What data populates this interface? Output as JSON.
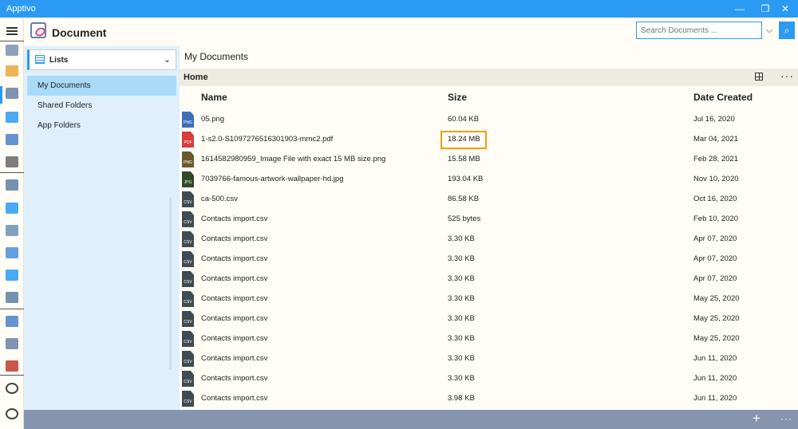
{
  "window": {
    "title": "Apptivo",
    "minimize": "—",
    "restore": "❐",
    "close": "✕"
  },
  "header": {
    "title": "Document",
    "search_placeholder": "Search Documents ...",
    "dropdown_glyph": "⌵",
    "search_glyph": "⌕"
  },
  "sidebar": {
    "select_label": "Lists",
    "select_chevron": "⌄",
    "items": [
      {
        "label": "My Documents",
        "active": true
      },
      {
        "label": "Shared Folders",
        "active": false
      },
      {
        "label": "App Folders",
        "active": false
      }
    ]
  },
  "main": {
    "breadcrumb": "My Documents",
    "folder": "Home",
    "more_glyph": "···",
    "columns": {
      "name": "Name",
      "size": "Size",
      "date": "Date Created"
    },
    "files": [
      {
        "name": "05.png",
        "size": "60.04 KB",
        "date": "Jul 16, 2020",
        "type": "PNG",
        "color": "#3d6fb6"
      },
      {
        "name": "1-s2.0-S1097276516301903-mmc2.pdf",
        "size": "18.24 MB",
        "date": "Mar 04, 2021",
        "type": "PDF",
        "color": "#d93c3c"
      },
      {
        "name": "1614582980959_Image File with exact 15 MB size.png",
        "size": "15.58 MB",
        "date": "Feb 28, 2021",
        "type": "PNG",
        "color": "#6b5a2a"
      },
      {
        "name": "7039766-famous-artwork-wallpaper-hd.jpg",
        "size": "193.04 KB",
        "date": "Nov 10, 2020",
        "type": "JPG",
        "color": "#2f4a2a"
      },
      {
        "name": "ca-500.csv",
        "size": "86.58 KB",
        "date": "Oct 16, 2020",
        "type": "CSV",
        "color": "#3e4b52"
      },
      {
        "name": "Contacts import.csv",
        "size": "525 bytes",
        "date": "Feb 10, 2020",
        "type": "CSV",
        "color": "#3e4b52"
      },
      {
        "name": "Contacts import.csv",
        "size": "3.30 KB",
        "date": "Apr 07, 2020",
        "type": "CSV",
        "color": "#3e4b52"
      },
      {
        "name": "Contacts import.csv",
        "size": "3.30 KB",
        "date": "Apr 07, 2020",
        "type": "CSV",
        "color": "#3e4b52"
      },
      {
        "name": "Contacts import.csv",
        "size": "3.30 KB",
        "date": "Apr 07, 2020",
        "type": "CSV",
        "color": "#3e4b52"
      },
      {
        "name": "Contacts import.csv",
        "size": "3.30 KB",
        "date": "May 25, 2020",
        "type": "CSV",
        "color": "#3e4b52"
      },
      {
        "name": "Contacts import.csv",
        "size": "3.30 KB",
        "date": "May 25, 2020",
        "type": "CSV",
        "color": "#3e4b52"
      },
      {
        "name": "Contacts import.csv",
        "size": "3.30 KB",
        "date": "May 25, 2020",
        "type": "CSV",
        "color": "#3e4b52"
      },
      {
        "name": "Contacts import.csv",
        "size": "3.30 KB",
        "date": "Jun 11, 2020",
        "type": "CSV",
        "color": "#3e4b52"
      },
      {
        "name": "Contacts import.csv",
        "size": "3.30 KB",
        "date": "Jun 11, 2020",
        "type": "CSV",
        "color": "#3e4b52"
      },
      {
        "name": "Contacts import.csv",
        "size": "3.98 KB",
        "date": "Jun 11, 2020",
        "type": "CSV",
        "color": "#3e4b52"
      }
    ]
  },
  "footer": {
    "add_glyph": "+",
    "more_glyph": "···"
  },
  "rail": {
    "icons": [
      {
        "name": "calendar-31-icon",
        "color": "#7a8fb0"
      },
      {
        "name": "notepad-icon",
        "color": "#e7a83b"
      },
      {
        "name": "document-icon",
        "color": "#6b7fa6"
      },
      {
        "name": "contacts-icon",
        "color": "#2b9af3"
      },
      {
        "name": "mail-icon",
        "color": "#4a7fc9"
      },
      {
        "name": "invoice-icon",
        "color": "#666"
      },
      {
        "name": "support-icon",
        "color": "#5a7fa6"
      },
      {
        "name": "cloud-icon",
        "color": "#2b9af3"
      },
      {
        "name": "money-bag-icon",
        "color": "#6b8fb6"
      },
      {
        "name": "network-icon",
        "color": "#4a8fd9"
      },
      {
        "name": "funnel-icon",
        "color": "#2b9af3"
      },
      {
        "name": "building-icon",
        "color": "#5a7fa6"
      },
      {
        "name": "shopping-bag-icon",
        "color": "#4a7fc9"
      },
      {
        "name": "truck-icon",
        "color": "#6b7fa6"
      },
      {
        "name": "ledger-icon",
        "color": "#c0392b"
      },
      {
        "name": "settings-gear-icon",
        "color": "#222"
      },
      {
        "name": "power-icon",
        "color": "#222"
      }
    ]
  },
  "colors": {
    "accent": "#2b9af3",
    "highlight": "#f19b15",
    "sidebar": "#dff0fc",
    "selected": "#a9dbf8",
    "footer": "#8695ae"
  }
}
